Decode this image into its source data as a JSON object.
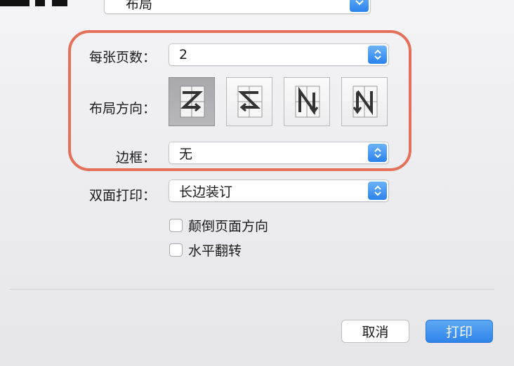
{
  "top_section": {
    "value": "布局"
  },
  "pages_per_sheet": {
    "label": "每张页数：",
    "value": "2"
  },
  "layout_direction": {
    "label": "布局方向：",
    "options": [
      {
        "icon": "z-order-icon",
        "selected": true
      },
      {
        "icon": "reverse-z-order-icon",
        "selected": false
      },
      {
        "icon": "n-reverse-order-icon",
        "selected": false
      },
      {
        "icon": "n-order-icon",
        "selected": false
      }
    ]
  },
  "border": {
    "label": "边框：",
    "value": "无"
  },
  "two_sided": {
    "label": "双面打印：",
    "value": "长边装订"
  },
  "checkboxes": [
    {
      "label": "颠倒页面方向",
      "checked": false
    },
    {
      "label": "水平翻转",
      "checked": false
    }
  ],
  "buttons": {
    "cancel": "取消",
    "print": "打印"
  },
  "colors": {
    "accent": "#2e84e8",
    "highlight_ring": "#e5705a"
  }
}
